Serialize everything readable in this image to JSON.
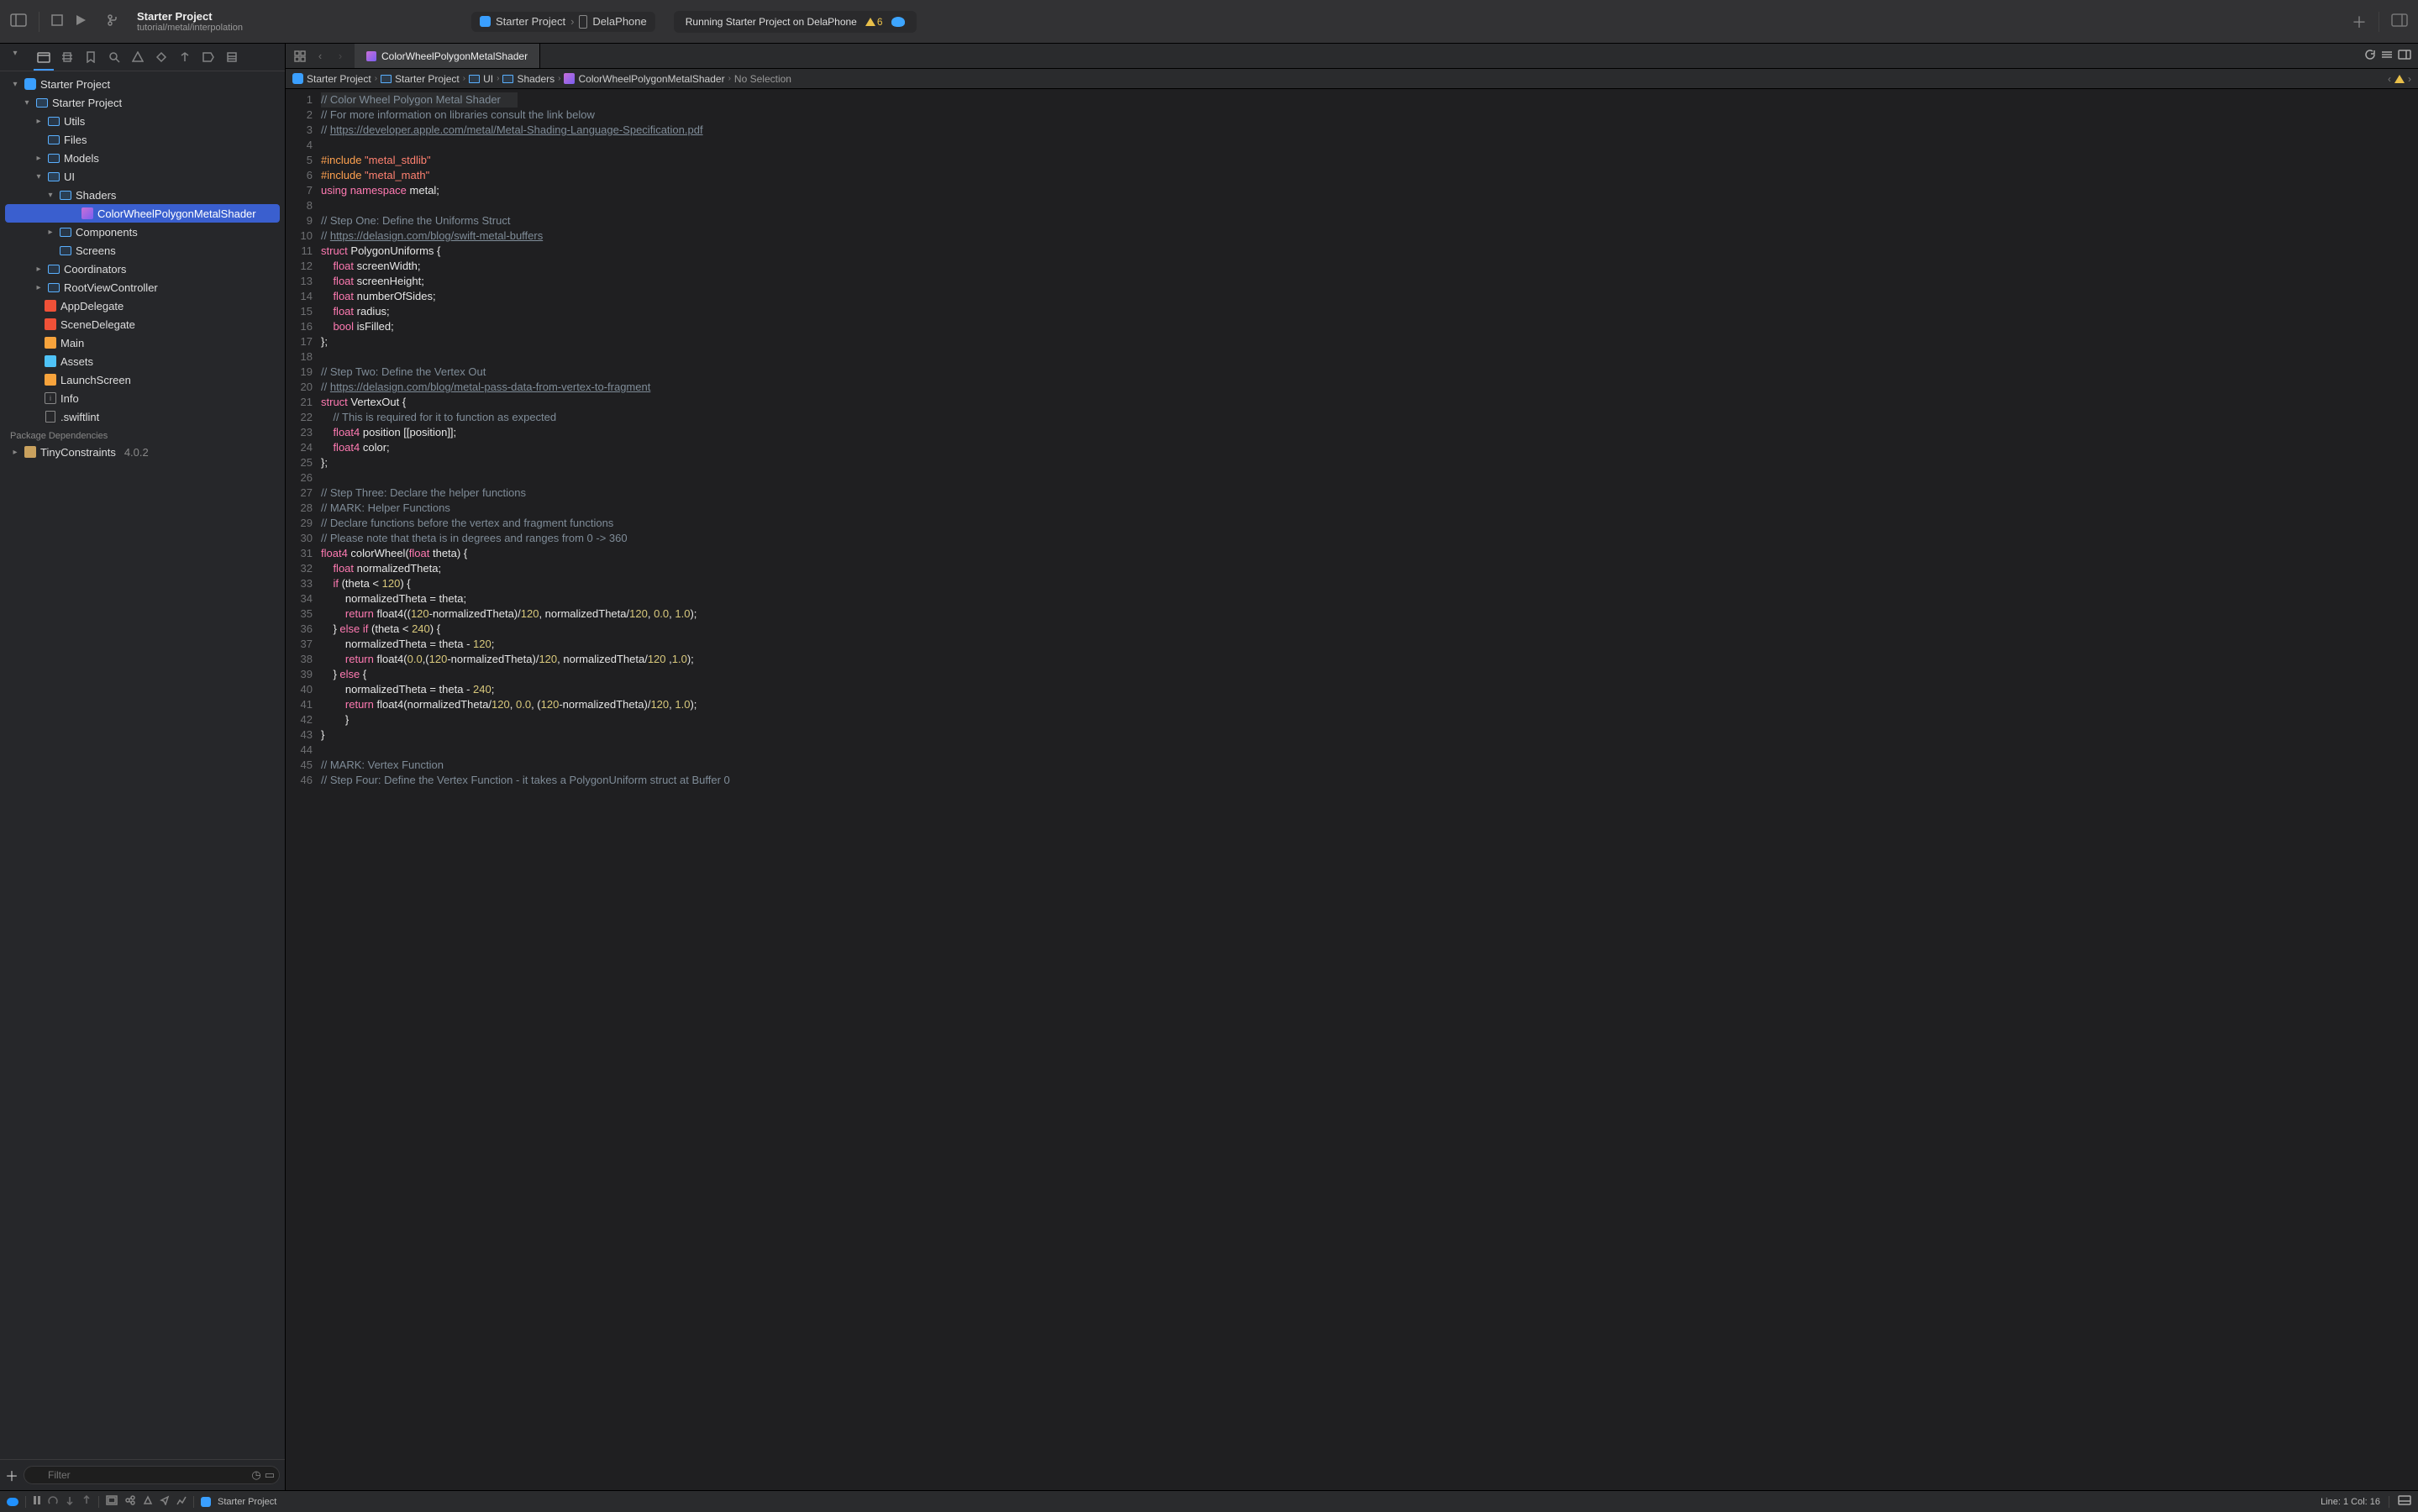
{
  "header": {
    "project_name": "Starter Project",
    "project_subtitle": "tutorial/metal/interpolation",
    "scheme": "Starter Project",
    "device": "DelaPhone",
    "status": "Running Starter Project on DelaPhone",
    "warn_count": "6"
  },
  "sidebar": {
    "root": "Starter Project",
    "root_child": "Starter Project",
    "items": [
      "Utils",
      "Files",
      "Models",
      "UI"
    ],
    "ui_children": [
      "Shaders"
    ],
    "shader_item": "ColorWheelPolygonMetalShader",
    "ui_children2": [
      "Components",
      "Screens"
    ],
    "after_ui": [
      "Coordinators",
      "RootViewController"
    ],
    "swift_items": [
      "AppDelegate",
      "SceneDelegate"
    ],
    "main_item": "Main",
    "assets_item": "Assets",
    "launch_item": "LaunchScreen",
    "info_item": "Info",
    "swiftlint_item": ".swiftlint",
    "pkg_header": "Package Dependencies",
    "pkg_name": "TinyConstraints",
    "pkg_version": "4.0.2",
    "filter_placeholder": "Filter"
  },
  "tabs": {
    "active": "ColorWheelPolygonMetalShader"
  },
  "breadcrumb": {
    "b0": "Starter Project",
    "b1": "Starter Project",
    "b2": "UI",
    "b3": "Shaders",
    "b4": "ColorWheelPolygonMetalShader",
    "b5": "No Selection"
  },
  "code": {
    "l1": "// Color Wheel Polygon Metal Shader",
    "l2": "// For more information on libraries consult the link below",
    "l3a": "// ",
    "l3b": "https://developer.apple.com/metal/Metal-Shading-Language-Specification.pdf",
    "l4": "",
    "l5a": "#include",
    "l5b": " \"metal_stdlib\"",
    "l6a": "#include",
    "l6b": " \"metal_math\"",
    "l7a": "using",
    "l7b": " namespace",
    "l7c": " metal;",
    "l8": "",
    "l9": "// Step One: Define the Uniforms Struct",
    "l10a": "// ",
    "l10b": "https://delasign.com/blog/swift-metal-buffers",
    "l11a": "struct",
    "l11b": " PolygonUniforms {",
    "l12a": "    float",
    "l12b": " screenWidth;",
    "l13a": "    float",
    "l13b": " screenHeight;",
    "l14a": "    float",
    "l14b": " numberOfSides;",
    "l15a": "    float",
    "l15b": " radius;",
    "l16a": "    bool",
    "l16b": " isFilled;",
    "l17": "};",
    "l18": "",
    "l19": "// Step Two: Define the Vertex Out",
    "l20a": "// ",
    "l20b": "https://delasign.com/blog/metal-pass-data-from-vertex-to-fragment",
    "l21a": "struct",
    "l21b": " VertexOut {",
    "l22": "    // This is required for it to function as expected",
    "l23a": "    float4",
    "l23b": " position [[position]];",
    "l24a": "    float4",
    "l24b": " color;",
    "l25": "};",
    "l26": "",
    "l27": "// Step Three: Declare the helper functions",
    "l28": "// MARK: Helper Functions",
    "l29": "// Declare functions before the vertex and fragment functions",
    "l30": "// Please note that theta is in degrees and ranges from 0 -> 360",
    "l31a": "float4",
    "l31b": " colorWheel(",
    "l31c": "float",
    "l31d": " theta) {",
    "l32a": "    float",
    "l32b": " normalizedTheta;",
    "l33a": "    if",
    "l33b": " (theta < ",
    "l33c": "120",
    "l33d": ") {",
    "l34": "        normalizedTheta = theta;",
    "l35a": "        return",
    "l35b": " float4((",
    "l35c": "120",
    "l35d": "-normalizedTheta)/",
    "l35e": "120",
    "l35f": ", normalizedTheta/",
    "l35g": "120",
    "l35h": ", ",
    "l35i": "0.0",
    "l35j": ", ",
    "l35k": "1.0",
    "l35l": ");",
    "l36a": "    } ",
    "l36b": "else",
    "l36c": " if",
    "l36d": " (theta < ",
    "l36e": "240",
    "l36f": ") {",
    "l37a": "        normalizedTheta = theta - ",
    "l37b": "120",
    "l37c": ";",
    "l38a": "        return",
    "l38b": " float4(",
    "l38c": "0.0",
    "l38d": ",(",
    "l38e": "120",
    "l38f": "-normalizedTheta)/",
    "l38g": "120",
    "l38h": ", normalizedTheta/",
    "l38i": "120",
    "l38j": " ,",
    "l38k": "1.0",
    "l38l": ");",
    "l39a": "    } ",
    "l39b": "else",
    "l39c": " {",
    "l40a": "        normalizedTheta = theta - ",
    "l40b": "240",
    "l40c": ";",
    "l41a": "        return",
    "l41b": " float4(normalizedTheta/",
    "l41c": "120",
    "l41d": ", ",
    "l41e": "0.0",
    "l41f": ", (",
    "l41g": "120",
    "l41h": "-normalizedTheta)/",
    "l41i": "120",
    "l41j": ", ",
    "l41k": "1.0",
    "l41l": ");",
    "l42": "        }",
    "l43": "}",
    "l44": "",
    "l45": "// MARK: Vertex Function",
    "l46": "// Step Four: Define the Vertex Function - it takes a PolygonUniform struct at Buffer 0"
  },
  "statusbar": {
    "branch": "Starter Project",
    "line_col": "Line: 1  Col: 16"
  }
}
